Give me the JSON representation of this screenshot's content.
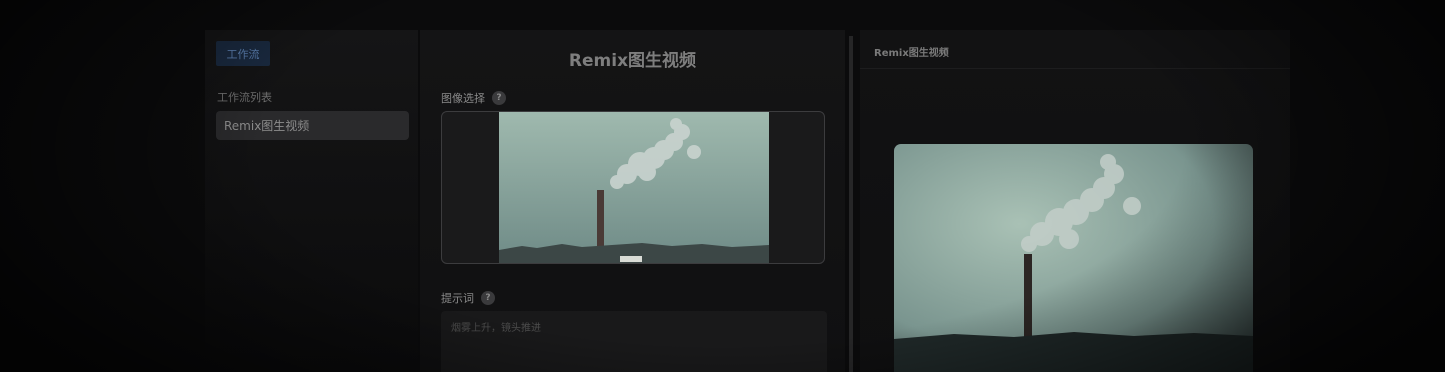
{
  "sidebar": {
    "tab_label": "工作流",
    "list_heading": "工作流列表",
    "items": [
      {
        "label": "Remix图生视频"
      }
    ]
  },
  "main": {
    "title": "Remix图生视频",
    "image_field": {
      "label": "图像选择",
      "help": "?"
    },
    "prompt_field": {
      "label": "提示词",
      "help": "?",
      "placeholder": "烟雾上升，镜头推进"
    }
  },
  "preview_panel": {
    "title": "Remix图生视频"
  },
  "colors": {
    "background": "#0b0b0c",
    "accent_tab": "#1a2a40",
    "sky": "#8fa8a0"
  },
  "icons": {
    "help": "question-circle-icon"
  }
}
